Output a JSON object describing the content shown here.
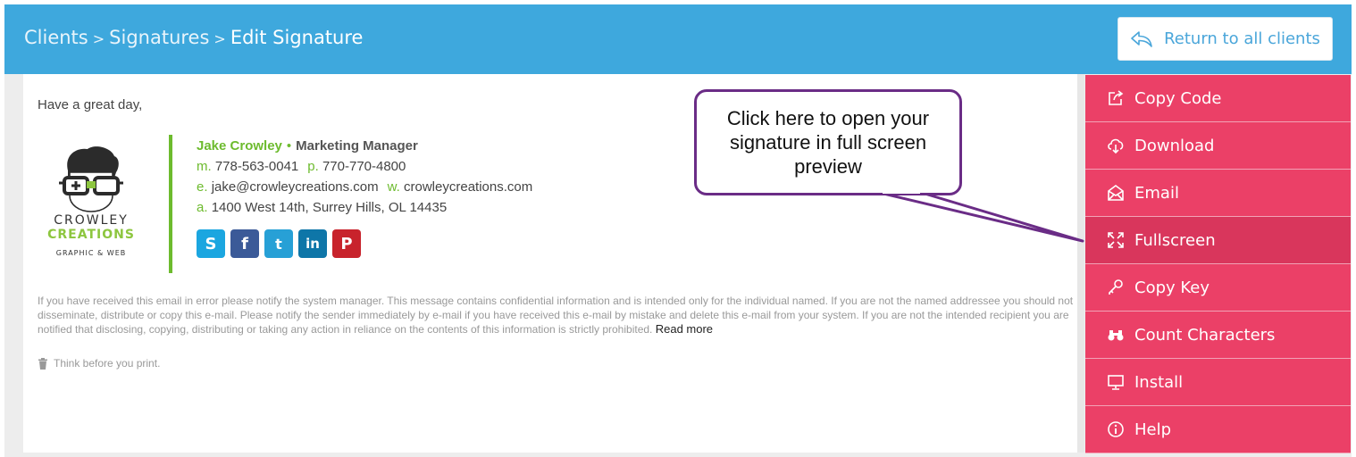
{
  "breadcrumb": {
    "items": [
      "Clients",
      "Signatures"
    ],
    "current": "Edit Signature",
    "separator": ">"
  },
  "header": {
    "return_label": "Return to all clients"
  },
  "preview": {
    "greeting": "Have a great day,",
    "logo": {
      "line1": "CROWLEY",
      "line2": "CREATIONS",
      "line3": "GRAPHIC & WEB"
    },
    "signature": {
      "name": "Jake Crowley",
      "bullet": "•",
      "role": "Marketing Manager",
      "mobile_label": "m.",
      "mobile": "778-563-0041",
      "phone_label": "p.",
      "phone": "770-770-4800",
      "email_label": "e.",
      "email": "jake@crowleycreations.com",
      "web_label": "w.",
      "web": "crowleycreations.com",
      "address_label": "a.",
      "address": "1400 West 14th, Surrey Hills, OL 14435"
    },
    "socials": [
      {
        "name": "skype",
        "glyph": "S",
        "color": "#1ba6e0"
      },
      {
        "name": "facebook",
        "glyph": "f",
        "color": "#3b5a98"
      },
      {
        "name": "twitter",
        "glyph": "t",
        "color": "#27a0d6"
      },
      {
        "name": "linkedin",
        "glyph": "in",
        "color": "#0e76a8"
      },
      {
        "name": "pinterest",
        "glyph": "P",
        "color": "#c8232c"
      }
    ],
    "disclaimer": "If you have received this email in error please notify the system manager. This message contains confidential information and is intended only for the individual named. If you are not the named addressee you should not disseminate, distribute or copy this e-mail. Please notify the sender immediately by e-mail if you have received this e-mail by mistake and delete this e-mail from your system. If you are not the intended recipient you are notified that disclosing, copying, distributing or taking any action in reliance on the contents of this information is strictly prohibited.",
    "read_more": "Read more",
    "print_note": "Think before you print."
  },
  "callout": {
    "text": "Click here to open your signature in full screen preview"
  },
  "sidebar": {
    "items": [
      {
        "label": "Copy Code",
        "icon": "share-icon"
      },
      {
        "label": "Download",
        "icon": "cloud-download-icon"
      },
      {
        "label": "Email",
        "icon": "envelope-open-icon"
      },
      {
        "label": "Fullscreen",
        "icon": "expand-icon",
        "active": true
      },
      {
        "label": "Copy Key",
        "icon": "key-icon"
      },
      {
        "label": "Count Characters",
        "icon": "binoculars-icon"
      },
      {
        "label": "Install",
        "icon": "monitor-icon"
      },
      {
        "label": "Help",
        "icon": "info-circle-icon"
      }
    ]
  },
  "colors": {
    "header": "#3ea8dd",
    "sidebar": "#eb4067",
    "sidebar_active": "#d9365c",
    "accent_green": "#6dbb2e",
    "callout_border": "#6a2c86"
  }
}
